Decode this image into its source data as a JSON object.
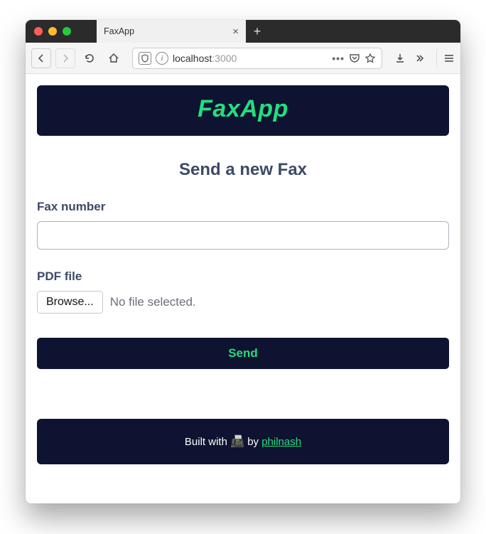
{
  "browser": {
    "tab_title": "FaxApp",
    "url_host": "localhost",
    "url_port": ":3000"
  },
  "page": {
    "app_name": "FaxApp",
    "heading": "Send a new Fax",
    "fax_number_label": "Fax number",
    "fax_number_value": "",
    "pdf_label": "PDF file",
    "browse_label": "Browse...",
    "file_status": "No file selected.",
    "send_label": "Send",
    "footer_prefix": "Built with ",
    "footer_by": " by ",
    "footer_author": "philnash"
  }
}
